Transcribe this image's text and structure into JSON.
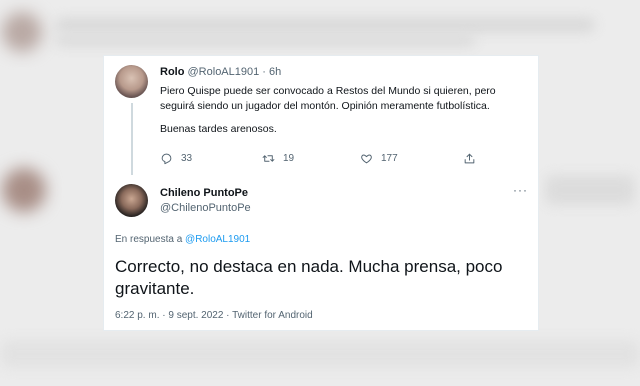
{
  "tweet1": {
    "name": "Rolo",
    "handle": "@RoloAL1901",
    "separator": "·",
    "time": "6h",
    "body_line1": "Piero Quispe puede ser convocado a Restos del Mundo si quieren, pero seguirá siendo un jugador del montón. Opinión meramente futbolística.",
    "body_line2": "Buenas tardes arenosos.",
    "actions": {
      "replies": "33",
      "retweets": "19",
      "likes": "177"
    },
    "icons": [
      "reply-icon",
      "retweet-icon",
      "like-icon",
      "share-icon"
    ]
  },
  "tweet2": {
    "name": "Chileno PuntoPe",
    "handle": "@ChilenoPuntoPe",
    "more": "···",
    "reply_prefix": "En respuesta a ",
    "reply_handle": "@RoloAL1901",
    "text": "Correcto, no destaca en nada. Mucha prensa, poco gravitante.",
    "timestamp": "6:22 p. m. · 9 sept. 2022 · Twitter for Android"
  },
  "colors": {
    "accent": "#1d9bf0",
    "text_primary": "#0f1419",
    "text_secondary": "#536471"
  }
}
